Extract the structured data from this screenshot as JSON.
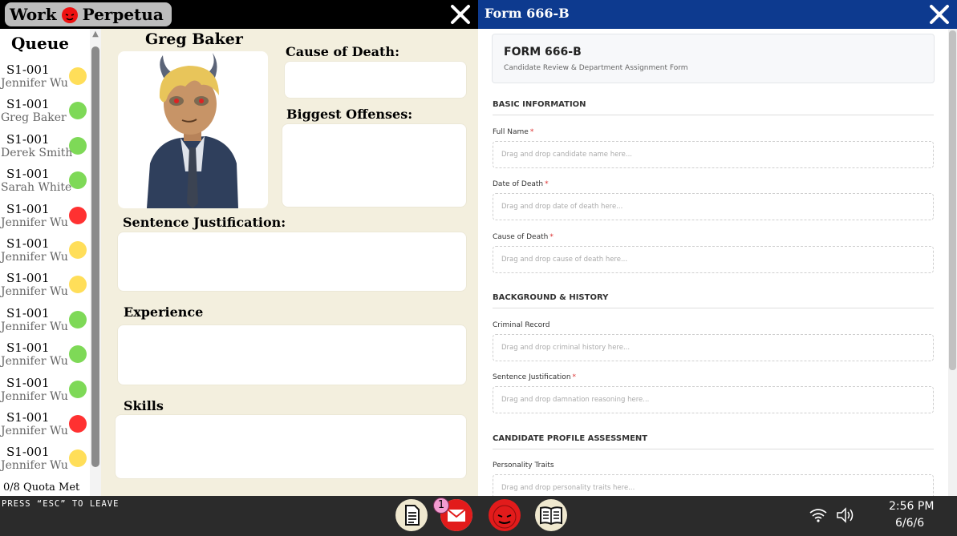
{
  "left_window": {
    "logo": {
      "word1": "Work",
      "word2": "Perpetua"
    },
    "queue": {
      "title": "Queue",
      "items": [
        {
          "id": "S1-001",
          "name": "Jennifer Wu",
          "status": "yellow"
        },
        {
          "id": "S1-001",
          "name": "Greg Baker",
          "status": "green"
        },
        {
          "id": "S1-001",
          "name": "Derek Smith",
          "status": "green"
        },
        {
          "id": "S1-001",
          "name": "Sarah White",
          "status": "green"
        },
        {
          "id": "S1-001",
          "name": "Jennifer Wu",
          "status": "red"
        },
        {
          "id": "S1-001",
          "name": "Jennifer Wu",
          "status": "yellow"
        },
        {
          "id": "S1-001",
          "name": "Jennifer Wu",
          "status": "yellow"
        },
        {
          "id": "S1-001",
          "name": "Jennifer Wu",
          "status": "green"
        },
        {
          "id": "S1-001",
          "name": "Jennifer Wu",
          "status": "green"
        },
        {
          "id": "S1-001",
          "name": "Jennifer Wu",
          "status": "green"
        },
        {
          "id": "S1-001",
          "name": "Jennifer Wu",
          "status": "red"
        },
        {
          "id": "S1-001",
          "name": "Jennifer Wu",
          "status": "yellow"
        }
      ],
      "quota": "0/8 Quota Met"
    },
    "profile": {
      "name": "Greg Baker",
      "cause_of_death_label": "Cause of Death:",
      "biggest_offenses_label": "Biggest Offenses:",
      "sentence_justification_label": "Sentence Justification:",
      "experience_label": "Experience",
      "skills_label": "Skills"
    }
  },
  "right_window": {
    "title": "Form 666-B",
    "form": {
      "code": "FORM 666-B",
      "subtitle": "Candidate Review & Department Assignment Form",
      "sections": {
        "basic": "BASIC INFORMATION",
        "background": "BACKGROUND & HISTORY",
        "profile": "CANDIDATE PROFILE ASSESSMENT"
      },
      "fields": {
        "full_name": {
          "label": "Full Name",
          "placeholder": "Drag and drop candidate name here..."
        },
        "date_of_death": {
          "label": "Date of Death",
          "placeholder": "Drag and drop date of death here..."
        },
        "cause_of_death": {
          "label": "Cause of Death",
          "placeholder": "Drag and drop cause of death here..."
        },
        "criminal_record": {
          "label": "Criminal Record",
          "placeholder": "Drag and drop criminal history here..."
        },
        "sentence_justification": {
          "label": "Sentence Justification",
          "placeholder": "Drag and drop damnation reasoning here..."
        },
        "personality_traits": {
          "label": "Personality Traits",
          "placeholder": "Drag and drop personality traits here..."
        }
      },
      "required_marker": "*"
    }
  },
  "taskbar": {
    "esc_hint": "PRESS “ESC” TO LEAVE",
    "dock": [
      "document-icon",
      "mail-icon",
      "devil-icon",
      "book-icon"
    ],
    "mail_badge": "1",
    "time": "2:56 PM",
    "date": "6/6/6"
  },
  "colors": {
    "status_green": "#7ed957",
    "status_yellow": "#ffde59",
    "status_red": "#ff3131",
    "form_titlebar": "#0d3a8f",
    "left_background": "#f3efde"
  }
}
